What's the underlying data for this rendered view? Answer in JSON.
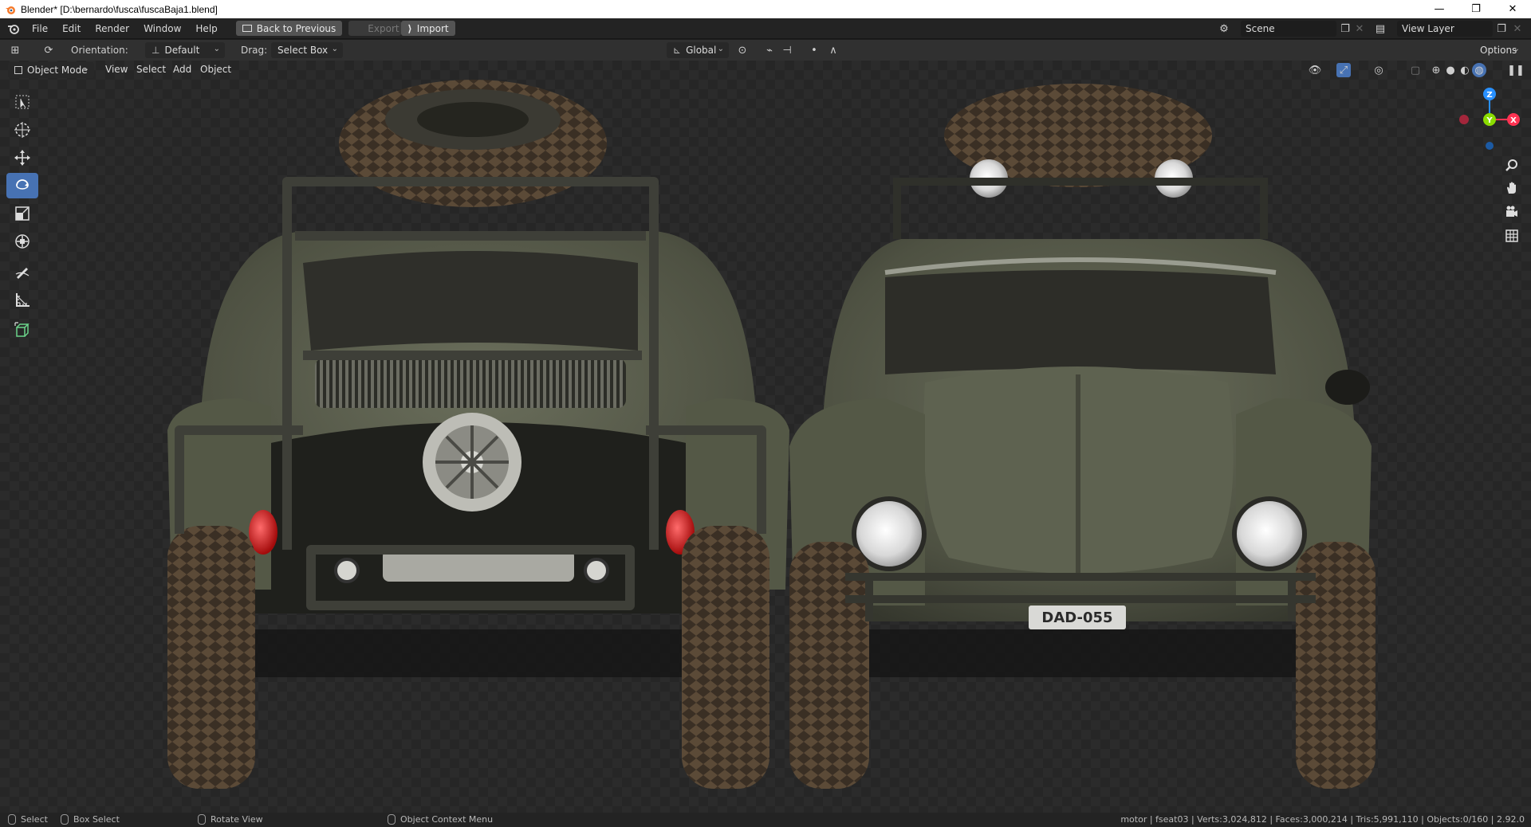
{
  "window": {
    "title": "Blender* [D:\\bernardo\\fusca\\fuscaBaja1.blend]",
    "minimize": "—",
    "maximize": "❐",
    "close": "✕"
  },
  "menu": {
    "items": [
      "File",
      "Edit",
      "Render",
      "Window",
      "Help"
    ],
    "back_to_previous": "Back to Previous",
    "export": "Export",
    "import": "Import",
    "scene": "Scene",
    "view_layer": "View Layer"
  },
  "tool_header": {
    "orientation_label": "Orientation:",
    "orientation_value": "Default",
    "drag_label": "Drag:",
    "drag_value": "Select Box",
    "transform_orientation": "Global",
    "options": "Options"
  },
  "viewport_header": {
    "mode": "Object Mode",
    "menus": [
      "View",
      "Select",
      "Add",
      "Object"
    ]
  },
  "toolbar": {
    "tools": [
      {
        "name": "select-box",
        "icon": "cursor-icon"
      },
      {
        "name": "cursor",
        "icon": "crosshair-icon"
      },
      {
        "name": "move",
        "icon": "move-icon"
      },
      {
        "name": "rotate",
        "icon": "rotate-icon",
        "active": true
      },
      {
        "name": "scale",
        "icon": "scale-icon"
      },
      {
        "name": "transform",
        "icon": "transform-icon"
      },
      {
        "name": "annotate",
        "icon": "pencil-icon"
      },
      {
        "name": "measure",
        "icon": "ruler-icon"
      },
      {
        "name": "add-cube",
        "icon": "cube-icon"
      }
    ]
  },
  "gizmo": {
    "z": "Z",
    "y": "Y",
    "x": "X"
  },
  "scene_content": {
    "plate_text": "DAD-055"
  },
  "statusbar": {
    "select": "Select",
    "box_select": "Box Select",
    "rotate_view": "Rotate View",
    "context_menu": "Object Context Menu",
    "stats": "motor | fseat03 | Verts:3,024,812 | Faces:3,000,214 | Tris:5,991,110 | Objects:0/160 | 2.92.0"
  },
  "colors": {
    "accent": "#4772b3",
    "gizmo_x": "#ff3352",
    "gizmo_y": "#8bdc00",
    "gizmo_z": "#2890ff",
    "car_body": "#5a5e4c",
    "tail_light": "#d91414"
  }
}
